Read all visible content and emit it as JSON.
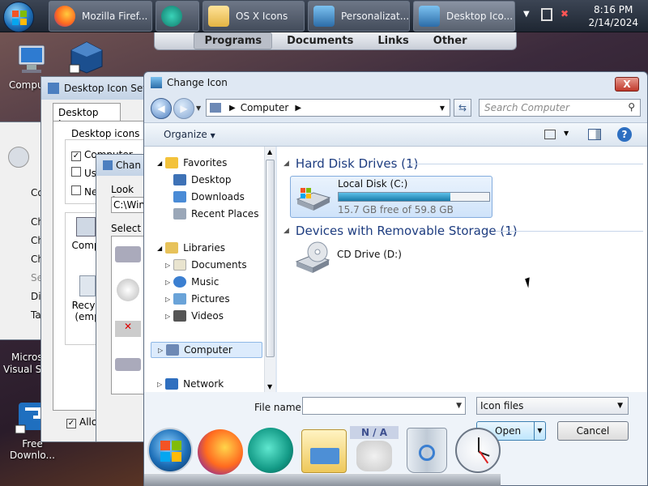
{
  "taskbar": {
    "tasks": [
      {
        "label": "Mozilla Firef...",
        "icon": "firefox-icon"
      },
      {
        "label": "",
        "icon": "app-icon"
      },
      {
        "label": "OS X Icons",
        "icon": "folder-icon"
      },
      {
        "label": "Personalizat...",
        "icon": "personalize-icon"
      },
      {
        "label": "Desktop Ico...",
        "icon": "desktop-icon-settings-icon"
      }
    ],
    "clock_time": "8:16 PM",
    "clock_date": "2/14/2024"
  },
  "programs_bar": {
    "items": [
      "Programs",
      "Documents",
      "Links",
      "Other"
    ],
    "selected": "Programs"
  },
  "desktop_icons": [
    {
      "label": "Compu..."
    },
    {
      "label": "Free Downlo..."
    }
  ],
  "background_windows": {
    "desktop_icon_settings": {
      "title": "Desktop Icon Setti",
      "tab": "Desktop Icons",
      "group": "Desktop icons",
      "items": [
        "Computer",
        "Use",
        "Ne"
      ],
      "icon_labels": [
        "Comp",
        "Recycl (emp"
      ],
      "allow_label": "Allow"
    },
    "change_icon_small": {
      "title": "Chan",
      "look_for": "Look for",
      "path": "C:\\Win",
      "select": "Select a"
    },
    "left_fragments": [
      "Co",
      "Ch",
      "Ch",
      "Ch",
      "Se",
      "Dis",
      "Ta"
    ],
    "left_bottom": [
      "Micros",
      "Visual St"
    ]
  },
  "dialog": {
    "title": "Change Icon",
    "close_label": "X",
    "address": "Computer",
    "search_placeholder": "Search Computer",
    "organize_label": "Organize",
    "nav": {
      "favorites": "Favorites",
      "desktop": "Desktop",
      "downloads": "Downloads",
      "recent": "Recent Places",
      "libraries": "Libraries",
      "documents": "Documents",
      "music": "Music",
      "pictures": "Pictures",
      "videos": "Videos",
      "computer": "Computer",
      "network": "Network"
    },
    "groups": {
      "hdd": "Hard Disk Drives (1)",
      "removable": "Devices with Removable Storage (1)"
    },
    "drives": {
      "c_label": "Local Disk (C:)",
      "c_free": "15.7 GB free of 59.8 GB",
      "c_used_fraction": 0.74,
      "d_label": "CD Drive (D:)"
    },
    "filename_label": "File name:",
    "filename_value": "",
    "filetype": "Icon files",
    "open_label": "Open",
    "cancel_label": "Cancel"
  },
  "colors": {
    "accent": "#1e3d80",
    "progress": "#187aa8"
  }
}
